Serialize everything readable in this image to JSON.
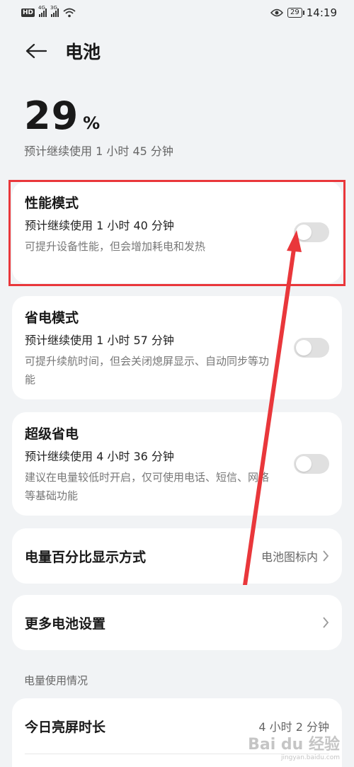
{
  "status_bar": {
    "hd": "HD",
    "net1": "4G",
    "net2": "3G",
    "battery_level": "29",
    "time": "14:19"
  },
  "header": {
    "title": "电池"
  },
  "battery": {
    "percent": "29",
    "percent_sign": "%",
    "remaining": "预计继续使用 1 小时 45 分钟"
  },
  "modes": [
    {
      "name": "性能模式",
      "estimate": "预计继续使用 1 小时 40 分钟",
      "desc": "可提升设备性能，但会增加耗电和发热",
      "enabled": false
    },
    {
      "name": "省电模式",
      "estimate": "预计继续使用 1 小时 57 分钟",
      "desc": "可提升续航时间，但会关闭熄屏显示、自动同步等功能",
      "enabled": false
    },
    {
      "name": "超级省电",
      "estimate": "预计继续使用 4 小时 36 分钟",
      "desc": "建议在电量较低时开启，仅可使用电话、短信、网络等基础功能",
      "enabled": false
    }
  ],
  "display_mode": {
    "label": "电量百分比显示方式",
    "value": "电池图标内"
  },
  "more_settings": {
    "label": "更多电池设置"
  },
  "usage": {
    "section_title": "电量使用情况",
    "screen_time_label": "今日亮屏时长",
    "screen_time_value": "4 小时 2 分钟"
  },
  "watermark": {
    "text": "Bai du 经验",
    "sub": "jingyan.baidu.com"
  },
  "colors": {
    "annotation": "#e9373b",
    "background": "#f1f3f5",
    "card": "#ffffff"
  }
}
